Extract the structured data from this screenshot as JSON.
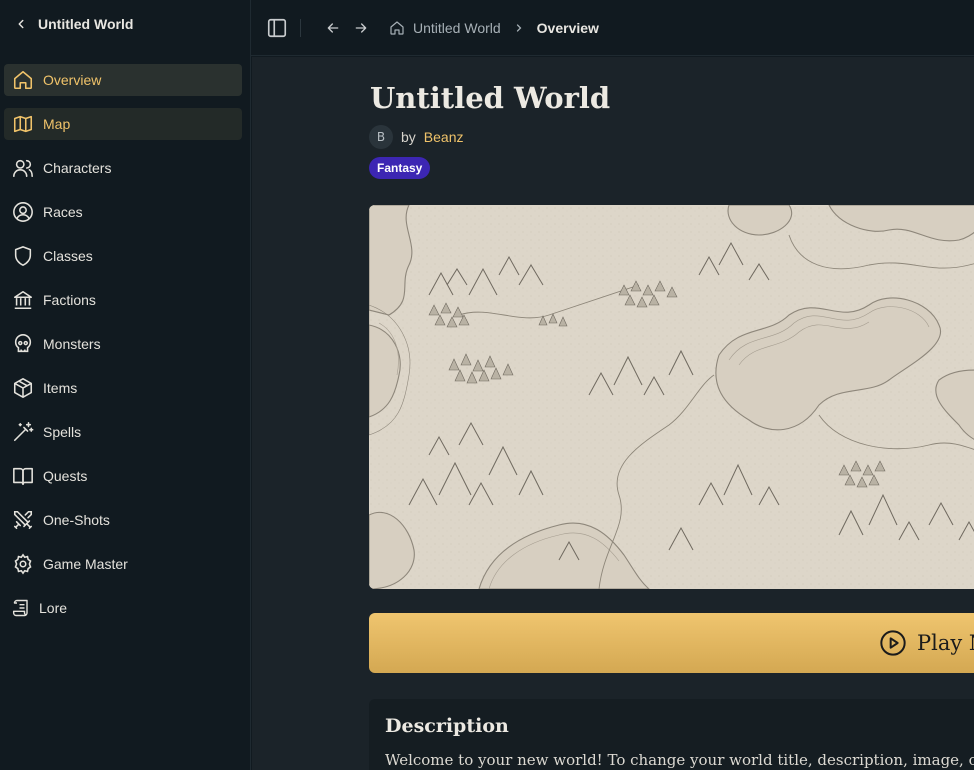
{
  "sidebar": {
    "back_icon": "chevron-left-icon",
    "title": "Untitled World",
    "items": [
      {
        "label": "Overview",
        "icon": "home-icon"
      },
      {
        "label": "Map",
        "icon": "map-icon"
      },
      {
        "label": "Characters",
        "icon": "users-icon"
      },
      {
        "label": "Races",
        "icon": "user-circle-icon"
      },
      {
        "label": "Classes",
        "icon": "shield-icon"
      },
      {
        "label": "Factions",
        "icon": "landmark-icon"
      },
      {
        "label": "Monsters",
        "icon": "skull-icon"
      },
      {
        "label": "Items",
        "icon": "box-icon"
      },
      {
        "label": "Spells",
        "icon": "wand-icon"
      },
      {
        "label": "Quests",
        "icon": "book-open-icon"
      },
      {
        "label": "One-Shots",
        "icon": "swords-icon"
      },
      {
        "label": "Game Master",
        "icon": "gear-icon"
      },
      {
        "label": "Lore",
        "icon": "scroll-icon"
      }
    ]
  },
  "topbar": {
    "crumbs": [
      "Untitled World",
      "Overview"
    ]
  },
  "world": {
    "title": "Untitled World",
    "avatar_initial": "B",
    "by": "by",
    "author": "Beanz",
    "genre": "Fantasy",
    "play_label": "Play N",
    "description_title": "Description",
    "description_text": "Welcome to your new world! To change your world title, description, image, or"
  },
  "colors": {
    "accent": "#f0c36a",
    "genre_badge": "#3c26b3",
    "background": "#111a20",
    "main_background": "#1b2329"
  }
}
